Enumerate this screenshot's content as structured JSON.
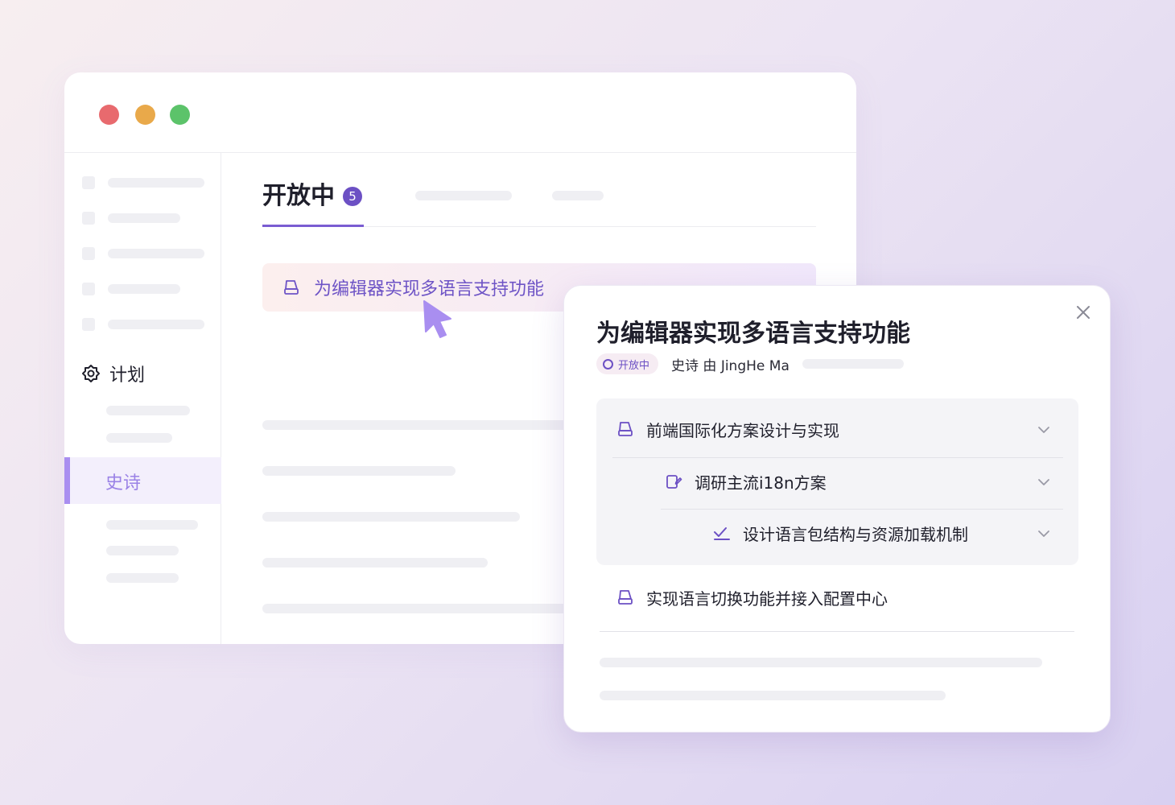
{
  "window": {
    "traffic_lights": [
      "close",
      "minimize",
      "maximize"
    ]
  },
  "sidebar": {
    "plan_label": "计划",
    "epic_label": "史诗"
  },
  "main": {
    "tab_title": "开放中",
    "tab_count": "5",
    "issue_title": "为编辑器实现多语言支持功能"
  },
  "modal": {
    "title": "为编辑器实现多语言支持功能",
    "status": "开放中",
    "meta": "史诗 由 JingHe Ma",
    "tree": [
      {
        "label": "前端国际化方案设计与实现",
        "icon": "epic-icon"
      },
      {
        "label": "调研主流i18n方案",
        "icon": "story-icon"
      },
      {
        "label": "设计语言包结构与资源加载机制",
        "icon": "task-check-icon"
      }
    ],
    "extra_item": {
      "label": "实现语言切换功能并接入配置中心",
      "icon": "epic-icon"
    }
  },
  "colors": {
    "accent": "#6c50c4",
    "accent_light": "#a98ef0",
    "close": "#e86a6e",
    "minimize": "#e9a94a",
    "maximize": "#5cc36a"
  }
}
